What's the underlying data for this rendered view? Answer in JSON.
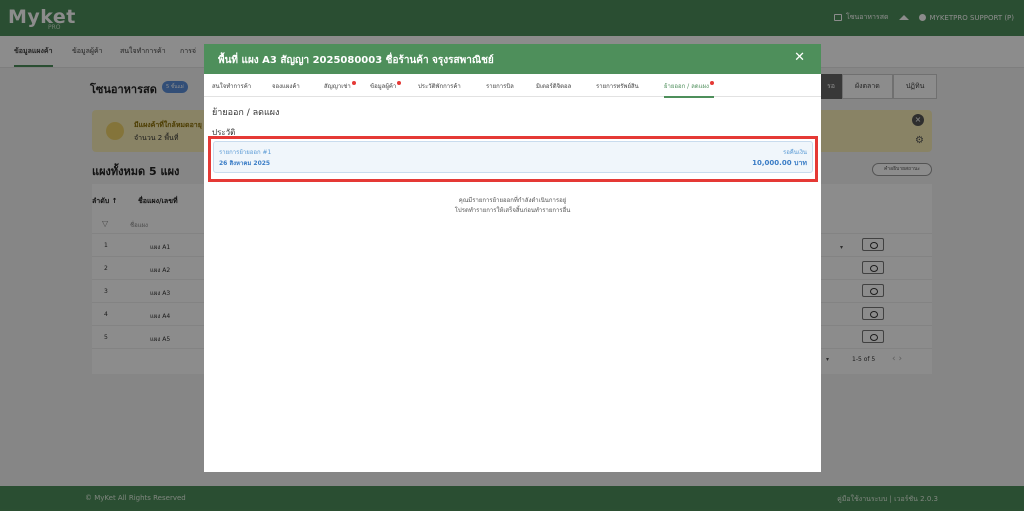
{
  "app": {
    "logo": "Myket",
    "logo_sub": "PRO",
    "top_zone": "โซนอาหารสด",
    "user": "MYKETPRO SUPPORT (P)"
  },
  "nav": {
    "items": [
      "ข้อมูลแผงค้า",
      "ข้อมูลผู้ค้า",
      "สนใจทำการค้า",
      "การจ่"
    ]
  },
  "page": {
    "zone_title": "โซนอาหารสด",
    "zone_badge": "5 ชั้นแผ่",
    "right_tabs": [
      "รอ",
      "ผังตลาด",
      "ปฏิทิน"
    ],
    "alert_title": "มีแผงค้าที่ใกล้หมดอายุ",
    "alert_sub": "จำนวน 2 พื้นที่",
    "total_title": "แผงทั้งหมด 5 แผง",
    "desc_button": "คำอธิบายสถานะ",
    "columns": [
      "ลำดับ ↑",
      "ชื่อแผง/เลขที่"
    ],
    "filter_placeholder": "ชื่อแผง",
    "rows": [
      {
        "n": "1",
        "name": "แผง A1"
      },
      {
        "n": "2",
        "name": "แผง A2"
      },
      {
        "n": "3",
        "name": "แผง A3"
      },
      {
        "n": "4",
        "name": "แผง A4"
      },
      {
        "n": "5",
        "name": "แผง A5"
      }
    ],
    "pager": "1-5 of 5",
    "pager_arrows": "‹     ›"
  },
  "modal": {
    "title": "พื้นที่ แผง A3 สัญญา 2025080003 ชื่อร้านค้า จรุงรสพาณิชย์",
    "close": "✕",
    "tabs": [
      {
        "label": "สนใจทำการค้า",
        "dot": false,
        "active": false
      },
      {
        "label": "จองแผงค้า",
        "dot": false,
        "active": false
      },
      {
        "label": "สัญญาเช่า",
        "dot": true,
        "active": false
      },
      {
        "label": "ข้อมูลผู้ค้า",
        "dot": true,
        "active": false
      },
      {
        "label": "ประวัติพักการค้า",
        "dot": false,
        "active": false
      },
      {
        "label": "รายการบิล",
        "dot": false,
        "active": false
      },
      {
        "label": "มิเตอร์ดิจิตอล",
        "dot": false,
        "active": false
      },
      {
        "label": "รายการทรัพย์สิน",
        "dot": false,
        "active": false
      },
      {
        "label": "ย้ายออก / ลดแผง",
        "dot": true,
        "active": true
      }
    ],
    "section_title": "ย้ายออก / ลดแผง",
    "history_label": "ประวัติ",
    "history": {
      "title": "รายการย้ายออก #1",
      "date": "26 สิงหาคม 2025",
      "status": "รอคืนเงิน",
      "amount": "10,000.00 บาท"
    },
    "notice_line1": "คุณมีรายการย้ายออกที่กำลังดำเนินการอยู่",
    "notice_line2": "โปรดทำรายการให้เสร็จสิ้นก่อนทำรายการอื่น"
  },
  "footer": {
    "left": "© MyKet All Rights Reserved",
    "right": "คู่มือใช้งานระบบ | เวอร์ชัน 2.0.3"
  },
  "colors": {
    "brand_green": "#4e8f5b",
    "highlight_red": "#e53935",
    "info_blue": "#3b7dc6"
  }
}
